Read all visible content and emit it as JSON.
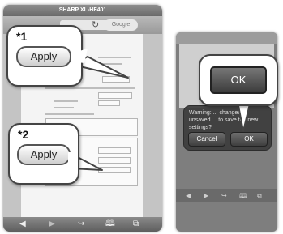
{
  "left_phone": {
    "title": "SHARP XL-HF401",
    "search_placeholder": "Google",
    "toolbar_icons": [
      "back-arrow",
      "forward-arrow",
      "share",
      "bookmarks",
      "tabs"
    ]
  },
  "callout_1": {
    "marker": "*1",
    "button_label": "Apply"
  },
  "callout_2": {
    "marker": "*2",
    "button_label": "Apply"
  },
  "right_phone": {
    "dialog_text": "Warning: ... changes to unsaved ... to save the new settings?",
    "cancel_label": "Cancel",
    "ok_label": "OK"
  },
  "ok_callout": {
    "button_label": "OK"
  }
}
